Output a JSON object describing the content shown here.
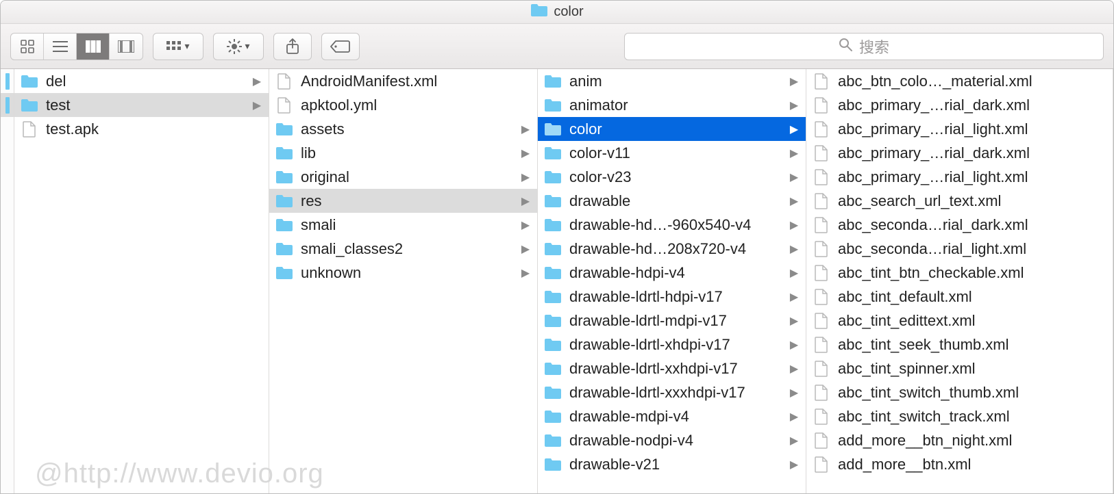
{
  "title": "color",
  "search_placeholder": "搜索",
  "watermark": "@http://www.devio.org",
  "columns": [
    {
      "items": [
        {
          "name": "del",
          "type": "folder",
          "has_children": true,
          "selected": "none"
        },
        {
          "name": "test",
          "type": "folder",
          "has_children": true,
          "selected": "gray"
        },
        {
          "name": "test.apk",
          "type": "file",
          "has_children": false,
          "selected": "none"
        }
      ]
    },
    {
      "items": [
        {
          "name": "AndroidManifest.xml",
          "type": "file",
          "has_children": false,
          "selected": "none"
        },
        {
          "name": "apktool.yml",
          "type": "file",
          "has_children": false,
          "selected": "none"
        },
        {
          "name": "assets",
          "type": "folder",
          "has_children": true,
          "selected": "none"
        },
        {
          "name": "lib",
          "type": "folder",
          "has_children": true,
          "selected": "none"
        },
        {
          "name": "original",
          "type": "folder",
          "has_children": true,
          "selected": "none"
        },
        {
          "name": "res",
          "type": "folder",
          "has_children": true,
          "selected": "gray"
        },
        {
          "name": "smali",
          "type": "folder",
          "has_children": true,
          "selected": "none"
        },
        {
          "name": "smali_classes2",
          "type": "folder",
          "has_children": true,
          "selected": "none"
        },
        {
          "name": "unknown",
          "type": "folder",
          "has_children": true,
          "selected": "none"
        }
      ]
    },
    {
      "items": [
        {
          "name": "anim",
          "type": "folder",
          "has_children": true,
          "selected": "none"
        },
        {
          "name": "animator",
          "type": "folder",
          "has_children": true,
          "selected": "none"
        },
        {
          "name": "color",
          "type": "folder",
          "has_children": true,
          "selected": "blue"
        },
        {
          "name": "color-v11",
          "type": "folder",
          "has_children": true,
          "selected": "none"
        },
        {
          "name": "color-v23",
          "type": "folder",
          "has_children": true,
          "selected": "none"
        },
        {
          "name": "drawable",
          "type": "folder",
          "has_children": true,
          "selected": "none"
        },
        {
          "name": "drawable-hd…-960x540-v4",
          "type": "folder",
          "has_children": true,
          "selected": "none"
        },
        {
          "name": "drawable-hd…208x720-v4",
          "type": "folder",
          "has_children": true,
          "selected": "none"
        },
        {
          "name": "drawable-hdpi-v4",
          "type": "folder",
          "has_children": true,
          "selected": "none"
        },
        {
          "name": "drawable-ldrtl-hdpi-v17",
          "type": "folder",
          "has_children": true,
          "selected": "none"
        },
        {
          "name": "drawable-ldrtl-mdpi-v17",
          "type": "folder",
          "has_children": true,
          "selected": "none"
        },
        {
          "name": "drawable-ldrtl-xhdpi-v17",
          "type": "folder",
          "has_children": true,
          "selected": "none"
        },
        {
          "name": "drawable-ldrtl-xxhdpi-v17",
          "type": "folder",
          "has_children": true,
          "selected": "none"
        },
        {
          "name": "drawable-ldrtl-xxxhdpi-v17",
          "type": "folder",
          "has_children": true,
          "selected": "none"
        },
        {
          "name": "drawable-mdpi-v4",
          "type": "folder",
          "has_children": true,
          "selected": "none"
        },
        {
          "name": "drawable-nodpi-v4",
          "type": "folder",
          "has_children": true,
          "selected": "none"
        },
        {
          "name": "drawable-v21",
          "type": "folder",
          "has_children": true,
          "selected": "none"
        }
      ]
    },
    {
      "items": [
        {
          "name": "abc_btn_colo…_material.xml",
          "type": "file",
          "has_children": false,
          "selected": "none"
        },
        {
          "name": "abc_primary_…rial_dark.xml",
          "type": "file",
          "has_children": false,
          "selected": "none"
        },
        {
          "name": "abc_primary_…rial_light.xml",
          "type": "file",
          "has_children": false,
          "selected": "none"
        },
        {
          "name": "abc_primary_…rial_dark.xml",
          "type": "file",
          "has_children": false,
          "selected": "none"
        },
        {
          "name": "abc_primary_…rial_light.xml",
          "type": "file",
          "has_children": false,
          "selected": "none"
        },
        {
          "name": "abc_search_url_text.xml",
          "type": "file",
          "has_children": false,
          "selected": "none"
        },
        {
          "name": "abc_seconda…rial_dark.xml",
          "type": "file",
          "has_children": false,
          "selected": "none"
        },
        {
          "name": "abc_seconda…rial_light.xml",
          "type": "file",
          "has_children": false,
          "selected": "none"
        },
        {
          "name": "abc_tint_btn_checkable.xml",
          "type": "file",
          "has_children": false,
          "selected": "none"
        },
        {
          "name": "abc_tint_default.xml",
          "type": "file",
          "has_children": false,
          "selected": "none"
        },
        {
          "name": "abc_tint_edittext.xml",
          "type": "file",
          "has_children": false,
          "selected": "none"
        },
        {
          "name": "abc_tint_seek_thumb.xml",
          "type": "file",
          "has_children": false,
          "selected": "none"
        },
        {
          "name": "abc_tint_spinner.xml",
          "type": "file",
          "has_children": false,
          "selected": "none"
        },
        {
          "name": "abc_tint_switch_thumb.xml",
          "type": "file",
          "has_children": false,
          "selected": "none"
        },
        {
          "name": "abc_tint_switch_track.xml",
          "type": "file",
          "has_children": false,
          "selected": "none"
        },
        {
          "name": "add_more__btn_night.xml",
          "type": "file",
          "has_children": false,
          "selected": "none"
        },
        {
          "name": "add_more__btn.xml",
          "type": "file",
          "has_children": false,
          "selected": "none"
        }
      ]
    }
  ]
}
